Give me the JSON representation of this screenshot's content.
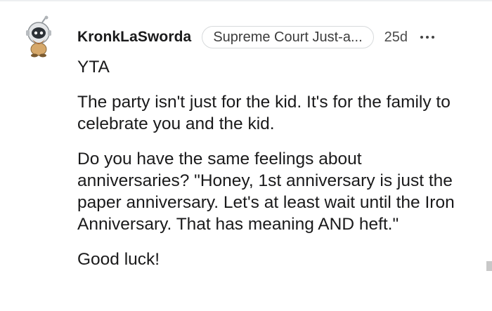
{
  "comment": {
    "author": "KronkLaSworda",
    "flair": "Supreme Court Just-a...",
    "timestamp": "25d",
    "avatar_icon": "snoo-astronaut-avatar-icon",
    "more_icon": "more-options-icon",
    "paragraphs": [
      "YTA",
      "The party isn't just for the kid. It's for the family to celebrate you and the kid.",
      "Do you have the same feelings about anniversaries? \"Honey, 1st anniversary is just the paper anniversary. Let's at least wait until the Iron Anniversary. That has meaning AND heft.\"",
      "Good luck!"
    ]
  }
}
